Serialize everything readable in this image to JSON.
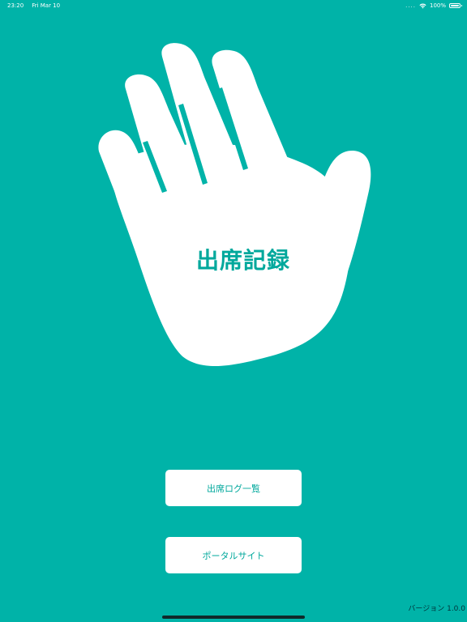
{
  "status_bar": {
    "time": "23:20",
    "date": "Fri Mar 10",
    "dots": "....",
    "battery": "100%",
    "wifi_icon": "wifi-icon",
    "battery_icon": "battery-icon"
  },
  "hero": {
    "title": "出席記録",
    "icon": "hand-icon"
  },
  "buttons": {
    "attendance_log": "出席ログ一覧",
    "portal_site": "ポータルサイト"
  },
  "footer": {
    "version": "バージョン 1.0.0"
  },
  "colors": {
    "background": "#00B3A8",
    "accent": "#00A89C",
    "button_bg": "#FFFFFF"
  }
}
